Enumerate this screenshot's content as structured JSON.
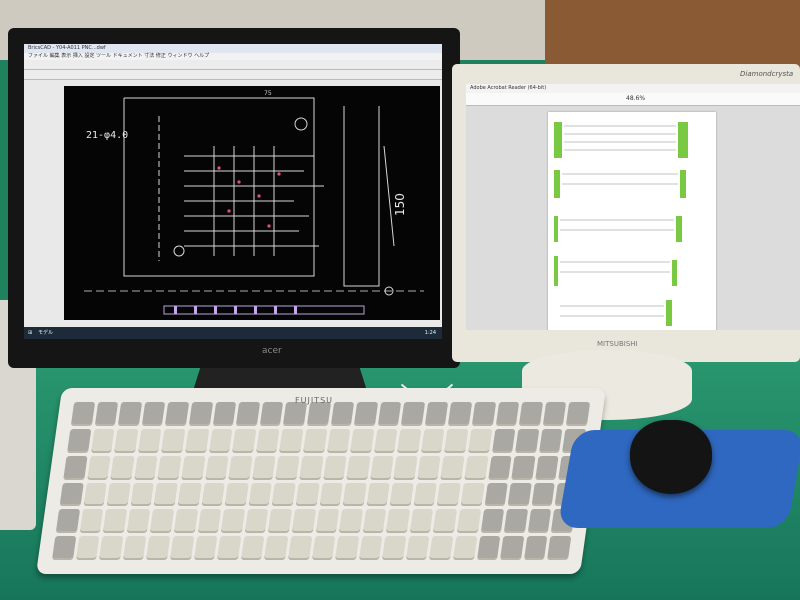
{
  "left_monitor": {
    "brand": "acer",
    "titlebar": "BricsCAD - Y04-A011 PNC...dwf",
    "menu": [
      "ファイル",
      "編集",
      "表示",
      "挿入",
      "設定",
      "ツール",
      "ドキュメント",
      "寸法",
      "修正",
      "ウィンドウ",
      "ヘルプ"
    ],
    "drawing_labels": {
      "hole_note": "21-φ4.0",
      "dimension_height": "150",
      "dimension_top": "75"
    },
    "tab_label": "モデル",
    "taskbar_time": "1:24"
  },
  "right_monitor": {
    "brand_bottom": "MITSUBISHI",
    "brand_top": "Diamondcrysta",
    "titlebar": "Adobe Acrobat Reader (64-bit)",
    "zoom": "48.6%"
  },
  "keyboard": {
    "brand": "FUJITSU"
  },
  "colors": {
    "desk": "#20815f",
    "cad_background": "#050505",
    "pdf_highlight": "#7ac943",
    "mousepad": "#2f68c0"
  }
}
